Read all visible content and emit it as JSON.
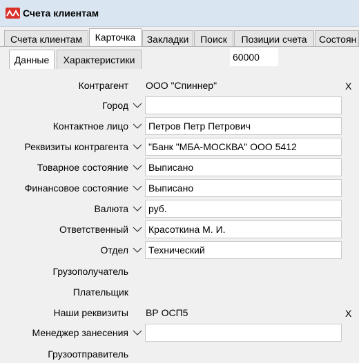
{
  "window": {
    "title": "Счета клиентам"
  },
  "tabs": [
    {
      "label": "Счета клиентам"
    },
    {
      "label": "Карточка"
    },
    {
      "label": "Закладки"
    },
    {
      "label": "Поиск"
    },
    {
      "label": "Позиции счета"
    },
    {
      "label": "Состоян"
    }
  ],
  "active_tab": "Карточка",
  "subtabs": [
    {
      "label": "Данные"
    },
    {
      "label": "Характеристики"
    }
  ],
  "active_subtab": "Данные",
  "record_id": "60000",
  "form": {
    "kontragent": {
      "label": "Контрагент",
      "value": "ООО \"Спиннер\"",
      "clear": "X"
    },
    "gorod": {
      "label": "Город",
      "value": ""
    },
    "kontakt": {
      "label": "Контактное лицо",
      "value": "Петров Петр Петрович"
    },
    "rekvizity": {
      "label": "Реквизиты контрагента",
      "value": "\"Банк \"МБА-МОСКВА\" ООО 5412"
    },
    "tovar": {
      "label": "Товарное состояние",
      "value": "Выписано"
    },
    "finans": {
      "label": "Финансовое состояние",
      "value": "Выписано"
    },
    "valuta": {
      "label": "Валюта",
      "value": "руб."
    },
    "otvetstv": {
      "label": "Ответственный",
      "value": "Красоткина М. И."
    },
    "otdel": {
      "label": "Отдел",
      "value": "Технический"
    },
    "gruzopoluchatel": {
      "label": "Грузополучатель"
    },
    "platelshchik": {
      "label": "Плательщик"
    },
    "nashi": {
      "label": "Наши реквизиты",
      "value": "ВР ОСП5",
      "clear": "X"
    },
    "menedzher": {
      "label": "Менеджер занесения",
      "value": ""
    },
    "gruzootpravitel": {
      "label": "Грузоотправитель"
    }
  },
  "colors": {
    "titlebar": "#d9e6f2",
    "logo": "#d9322b",
    "accent": "#0078d7"
  },
  "icons": {
    "app": "app-logo-icon",
    "dropdown": "chevron-down-icon"
  }
}
